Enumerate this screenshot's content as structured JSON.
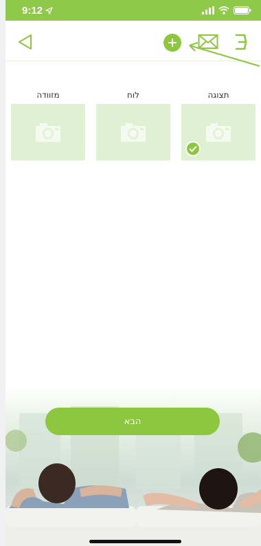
{
  "status_bar": {
    "time": "9:12",
    "icons": [
      "location-arrow-icon",
      "signal-icon",
      "wifi-icon",
      "battery-icon"
    ]
  },
  "top_bar": {
    "icons": [
      "back-arrow-icon",
      "add-circle-icon",
      "mail-icon",
      "menu-icon"
    ]
  },
  "tiles": [
    {
      "label": "תצוגה",
      "icon": "camera-icon",
      "selected": true
    },
    {
      "label": "לוח",
      "icon": "camera-icon",
      "selected": false
    },
    {
      "label": "מזוודה",
      "icon": "camera-icon",
      "selected": false
    }
  ],
  "next_button": {
    "label": "הבא"
  },
  "colors": {
    "accent": "#8dc63f",
    "status_bar": "#8fc94a",
    "tile_bg": "#dff0d3",
    "tile_icon": "#f4faf0"
  }
}
